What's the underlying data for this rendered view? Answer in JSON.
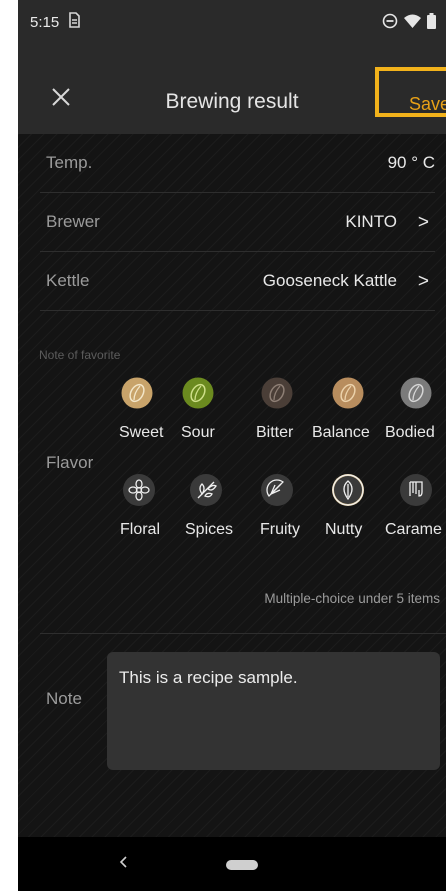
{
  "status_bar": {
    "time": "5:15",
    "notification_icon": "sim-icon",
    "icons": [
      "dnd-icon",
      "wifi-icon",
      "battery-icon"
    ]
  },
  "app_bar": {
    "title": "Brewing result",
    "save_label": "Save",
    "close_icon": "close-icon"
  },
  "fields": [
    {
      "label": "Temp.",
      "value": "90 ° C"
    },
    {
      "label": "Brewer",
      "value": "KINTO",
      "chevron": ">"
    },
    {
      "label": "Kettle",
      "value": "Gooseneck Kattle",
      "chevron": ">"
    }
  ],
  "favorite": {
    "section_label": "Note of favorite",
    "flavor_label": "Flavor",
    "taste_items": [
      {
        "name": "Sweet",
        "color": "#c8a36a",
        "icon": "bean-icon"
      },
      {
        "name": "Sour",
        "color": "#6b8a1f",
        "icon": "bean-icon"
      },
      {
        "name": "Bitter",
        "color": "#4a3e37",
        "icon": "bean-icon"
      },
      {
        "name": "Balance",
        "color": "#b88d5e",
        "icon": "bean-icon"
      },
      {
        "name": "Bodied",
        "color": "#7b7b7b",
        "icon": "bean-icon"
      }
    ],
    "aroma_items": [
      {
        "name": "Floral",
        "icon": "flower-icon",
        "selected": false
      },
      {
        "name": "Spices",
        "icon": "leaf-icon",
        "selected": false
      },
      {
        "name": "Fruity",
        "icon": "citrus-icon",
        "selected": false
      },
      {
        "name": "Nutty",
        "icon": "nut-icon",
        "selected": true
      },
      {
        "name": "Carame",
        "icon": "caramel-icon",
        "selected": false
      }
    ],
    "hint": "Multiple-choice under 5 items"
  },
  "note": {
    "label": "Note",
    "text": "This is a recipe sample."
  },
  "colors": {
    "accent": "#e7a017",
    "highlight_border": "#f2b21b",
    "background": "#141414",
    "bar": "#2a2a2a"
  }
}
